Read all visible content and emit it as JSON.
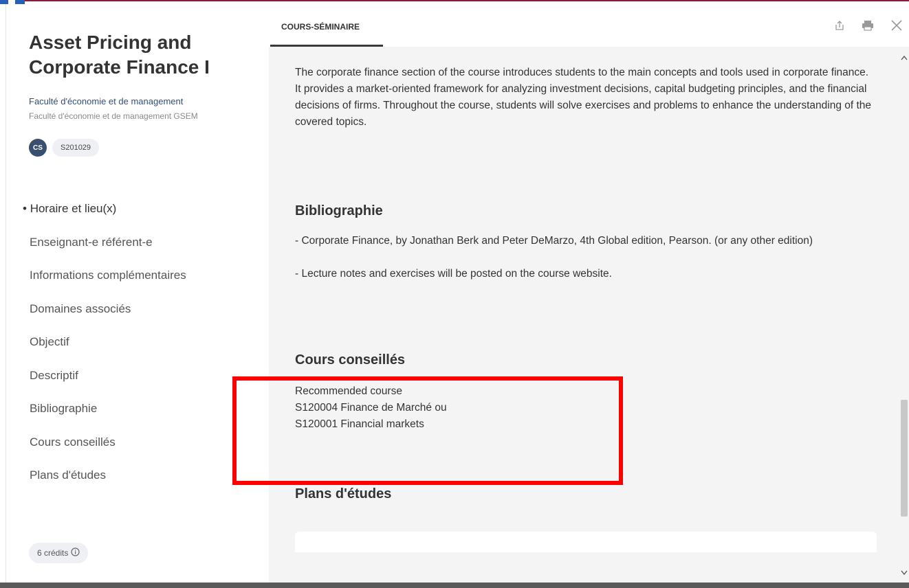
{
  "course": {
    "title": "Asset Pricing and Corporate Finance I",
    "faculty": "Faculté d'économie et de management",
    "faculty_sub": "Faculté d'économie et de management GSEM",
    "type_badge": "CS",
    "code": "S201029",
    "credits": "6 crédits",
    "credits_icon": "info-icon"
  },
  "nav": {
    "items": [
      "Horaire et lieu(x)",
      "Enseignant-e référent-e",
      "Informations complémentaires",
      "Domaines associés",
      "Objectif",
      "Descriptif",
      "Bibliographie",
      "Cours conseillés",
      "Plans d'études"
    ],
    "active_bullet": "•"
  },
  "tabs": {
    "active": "COURS-SÉMINAIRE",
    "icons": [
      "share-icon",
      "print-icon",
      "close-icon"
    ]
  },
  "content": {
    "intro": "The corporate finance section of the course introduces students to the main concepts and tools used in corporate finance. It provides a market-oriented framework for analyzing investment decisions, capital budgeting principles, and the financial decisions of firms. Throughout the course, students will solve exercises and problems to enhance the understanding of the covered topics.",
    "bibliography": {
      "title": "Bibliographie",
      "items": [
        "- Corporate Finance, by Jonathan Berk and Peter DeMarzo, 4th Global edition, Pearson. (or any other edition)",
        "- Lecture notes and exercises will be posted on the course website."
      ]
    },
    "recommended": {
      "title": "Cours conseillés",
      "lines": [
        "Recommended course",
        "S120004 Finance de Marché ou",
        "S120001 Financial markets"
      ]
    },
    "plans": {
      "title": "Plans d'études"
    }
  },
  "colors": {
    "highlight": "#ff0000",
    "faculty_link": "#2f4f7a",
    "badge": "#3a4e6e"
  }
}
